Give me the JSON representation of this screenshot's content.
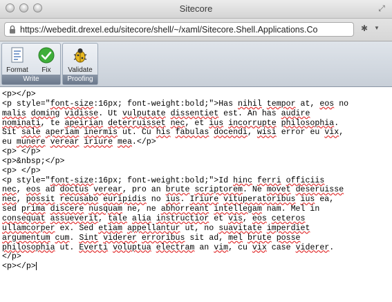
{
  "window": {
    "title": "Sitecore"
  },
  "address_bar": {
    "url": "https://webedit.drexel.edu/sitecore/shell/~/xaml/Sitecore.Shell.Applications.Co"
  },
  "toolbar": {
    "groups": [
      {
        "label": "Write",
        "buttons": [
          {
            "label": "Format",
            "icon": "document-lines-icon"
          },
          {
            "label": "Fix",
            "icon": "green-check-icon"
          }
        ]
      },
      {
        "label": "Proofing",
        "buttons": [
          {
            "label": "Validate",
            "icon": "bug-icon"
          }
        ]
      }
    ]
  },
  "editor": {
    "lines": [
      "<p></p>",
      "<p style=\"font-size:16px; font-weight:bold;\">Has nihil tempor at, eos no",
      "malis doming vidisse. Ut vulputate dissentiet est. An has audire",
      "nominati, te apeirian deterruisset nec, et ius incorrupte philosophia.",
      "Sit sale aperiam inermis ut. Cu his fabulas docendi, wisi error eu vix,",
      "eu munere verear iriure mea.</p>",
      "<p> </p>",
      "<p>&nbsp;</p>",
      "<p> </p>",
      "<p style=\"font-size:16px; font-weight:bold;\">Id hinc ferri officiis",
      "nec, eos ad doctus verear, pro an brute scriptorem. Ne movet deseruisse",
      "nec, possit recusabo euripidis no ius. Iriure vituperatoribus ius ea,",
      "sed prima discere nusquam ne, ne abhorreant intellegam nam. Mel in",
      "consequat assueverit, tale alia instructior et vis, eos ceteros",
      "ullamcorper ex. Sed etiam appellantur ut, no suavitate imperdiet",
      "argumentum cum. Sint viderer erroribus sit ad, mel brute posse",
      "philosophia ut. Everti voluptua electram an vim, cu vix case viderer.",
      "</p>",
      "<p></p>"
    ],
    "misspelled_words": [
      "font-size",
      "nihil",
      "tempor",
      "eos",
      "malis",
      "doming",
      "vidisse",
      "vulputate",
      "dissentiet",
      "audire",
      "nominati",
      "apeirian",
      "deterruisset",
      "nec",
      "ius",
      "incorrupte",
      "philosophia",
      "sale",
      "aperiam",
      "inermis",
      "his",
      "fabulas",
      "docendi",
      "wisi",
      "vix",
      "munere",
      "verear",
      "iriure",
      "mea",
      "hinc",
      "ferri",
      "officiis",
      "doctus",
      "brute",
      "scriptorem",
      "movet",
      "deseruisse",
      "possit",
      "recusabo",
      "euripidis",
      "Iriure",
      "vituperatoribus",
      "prima",
      "discere",
      "nusquam",
      "abhorreant",
      "intellegam",
      "consequat",
      "assueverit",
      "tale",
      "alia",
      "instructior",
      "vis",
      "ceteros",
      "ullamcorper",
      "etiam",
      "appellantur",
      "suavitate",
      "imperdiet",
      "argumentum",
      "cum",
      "Sint",
      "viderer",
      "erroribus",
      "mel",
      "posse",
      "Everti",
      "voluptua",
      "electram",
      "vim"
    ]
  }
}
